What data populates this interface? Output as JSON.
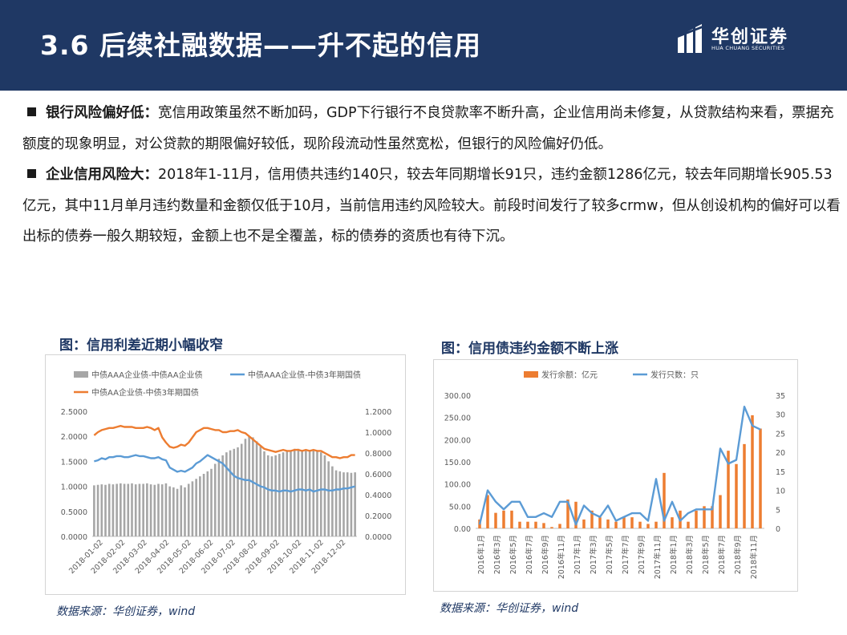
{
  "header": {
    "title": "3.6 后续社融数据——升不起的信用",
    "logo_cn": "华创证券",
    "logo_en": "HUA CHUANG SECURITIES",
    "bg_color": "#1f3864"
  },
  "paragraphs": [
    {
      "title": "银行风险偏好低",
      "sep": "：",
      "text": "宽信用政策虽然不断加码，GDP下行银行不良贷款率不断升高，企业信用尚未修复，从贷款结构来看，票据充额度的现象明显，对公贷款的期限偏好较低，现阶段流动性虽然宽松，但银行的风险偏好仍低。"
    },
    {
      "title": "企业信用风险大",
      "sep": "：",
      "text": "2018年1-11月，信用债共违约140只，较去年同期增长91只，违约金额1286亿元，较去年同期增长905.53亿元，其中11月单月违约数量和金额仅低于10月，当前信用违约风险较大。前段时间发行了较多crmw，但从创设机构的偏好可以看出标的债券一般久期较短，金额上也不是全覆盖，标的债券的资质也有待下沉。"
    }
  ],
  "figures": {
    "left_title": "图：信用利差近期小幅收窄",
    "right_title": "图：信用债违约金额不断上涨",
    "left_source": "数据来源：华创证券，wind",
    "right_source": "数据来源：华创证券，wind"
  },
  "chart_data": [
    {
      "type": "bar",
      "title": "",
      "legend": [
        "中债AAA企业债-中债AA企业债",
        "中债AAA企业债-中债3年期国债",
        "中债AA企业债-中债3年期国债"
      ],
      "legend_placement": "top",
      "colors": [
        "#a6a6a6",
        "#5b9bd5",
        "#ed7d31"
      ],
      "x_tick_labels": [
        "2018-01-02",
        "2018-02-02",
        "2018-03-02",
        "2018-04-02",
        "2018-05-02",
        "2018-06-02",
        "2018-07-02",
        "2018-08-02",
        "2018-09-02",
        "2018-10-02",
        "2018-11-02",
        "2018-12-02"
      ],
      "left_axis": {
        "ylim": [
          0,
          2.5
        ],
        "ticks": [
          "0.0000",
          "0.5000",
          "1.0000",
          "1.5000",
          "2.0000",
          "2.5000"
        ]
      },
      "right_axis": {
        "ylim": [
          0,
          1.2
        ],
        "ticks": [
          "0.0000",
          "0.2000",
          "0.4000",
          "0.6000",
          "0.8000",
          "1.0000",
          "1.2000"
        ]
      },
      "grid": false,
      "series": [
        {
          "name": "中债AAA企业债-中债AA企业债",
          "axis": "left",
          "kind": "bar",
          "values": [
            1.02,
            1.03,
            1.04,
            1.03,
            1.05,
            1.04,
            1.05,
            1.06,
            1.05,
            1.05,
            1.06,
            1.04,
            1.05,
            1.05,
            1.06,
            1.04,
            1.03,
            1.05,
            1.04,
            1.06,
            1.0,
            0.98,
            0.95,
            1.02,
            0.98,
            1.05,
            1.1,
            1.15,
            1.2,
            1.25,
            1.3,
            1.35,
            1.45,
            1.55,
            1.62,
            1.68,
            1.72,
            1.75,
            1.78,
            1.85,
            1.95,
            2.0,
            1.98,
            1.9,
            1.8,
            1.7,
            1.62,
            1.6,
            1.62,
            1.65,
            1.68,
            1.7,
            1.72,
            1.75,
            1.75,
            1.72,
            1.74,
            1.73,
            1.72,
            1.7,
            1.68,
            1.62,
            1.5,
            1.4,
            1.32,
            1.3,
            1.28,
            1.28,
            1.27,
            1.28
          ]
        },
        {
          "name": "中债AAA企业债-中债3年期国债",
          "axis": "right",
          "kind": "line",
          "values": [
            0.72,
            0.73,
            0.75,
            0.74,
            0.76,
            0.76,
            0.77,
            0.77,
            0.76,
            0.76,
            0.77,
            0.78,
            0.77,
            0.77,
            0.76,
            0.75,
            0.75,
            0.76,
            0.74,
            0.73,
            0.66,
            0.64,
            0.62,
            0.63,
            0.62,
            0.64,
            0.66,
            0.7,
            0.72,
            0.75,
            0.78,
            0.76,
            0.74,
            0.72,
            0.7,
            0.66,
            0.62,
            0.58,
            0.56,
            0.55,
            0.54,
            0.54,
            0.52,
            0.5,
            0.48,
            0.47,
            0.45,
            0.44,
            0.44,
            0.43,
            0.44,
            0.44,
            0.43,
            0.44,
            0.45,
            0.45,
            0.44,
            0.45,
            0.43,
            0.44,
            0.45,
            0.45,
            0.44,
            0.44,
            0.45,
            0.45,
            0.46,
            0.46,
            0.47,
            0.48
          ]
        },
        {
          "name": "中债AA企业债-中债3年期国债",
          "axis": "right",
          "kind": "line",
          "values": [
            0.97,
            1.0,
            1.02,
            1.03,
            1.04,
            1.04,
            1.05,
            1.06,
            1.05,
            1.05,
            1.05,
            1.04,
            1.04,
            1.04,
            1.05,
            1.04,
            1.02,
            1.04,
            0.95,
            0.9,
            0.86,
            0.85,
            0.86,
            0.88,
            0.87,
            0.9,
            0.95,
            1.0,
            1.02,
            1.04,
            1.04,
            1.03,
            1.02,
            1.02,
            1.0,
            1.0,
            1.01,
            1.01,
            1.02,
            1.0,
            0.99,
            0.96,
            0.93,
            0.9,
            0.87,
            0.84,
            0.83,
            0.82,
            0.81,
            0.82,
            0.83,
            0.82,
            0.82,
            0.83,
            0.83,
            0.82,
            0.83,
            0.82,
            0.83,
            0.82,
            0.82,
            0.8,
            0.78,
            0.76,
            0.76,
            0.75,
            0.76,
            0.76,
            0.78,
            0.78
          ]
        }
      ]
    },
    {
      "type": "bar",
      "title": "",
      "legend": [
        "发行余额：亿元",
        "发行只数：只"
      ],
      "legend_placement": "top",
      "colors": [
        "#ed7d31",
        "#5b9bd5"
      ],
      "x_tick_labels": [
        "2016年1月",
        "2016年3月",
        "2016年5月",
        "2016年7月",
        "2016年9月",
        "2016年11月",
        "2017年1月",
        "2017年3月",
        "2017年5月",
        "2017年7月",
        "2017年9月",
        "2017年11月",
        "2018年1月",
        "2018年3月",
        "2018年5月",
        "2018年7月",
        "2018年9月",
        "2018年11月"
      ],
      "left_axis": {
        "ylim": [
          0,
          300
        ],
        "ticks": [
          "0.00",
          "50.00",
          "100.00",
          "150.00",
          "200.00",
          "250.00",
          "300.00"
        ]
      },
      "right_axis": {
        "ylim": [
          0,
          35
        ],
        "ticks": [
          "0",
          "5",
          "10",
          "15",
          "20",
          "25",
          "30",
          "35"
        ]
      },
      "grid": false,
      "series": [
        {
          "name": "发行余额：亿元",
          "axis": "left",
          "kind": "bar",
          "values": [
            20,
            75,
            35,
            40,
            40,
            15,
            15,
            15,
            12,
            3,
            10,
            65,
            60,
            20,
            40,
            25,
            20,
            15,
            25,
            25,
            15,
            10,
            15,
            125,
            25,
            40,
            15,
            40,
            50,
            50,
            75,
            175,
            145,
            190,
            255,
            225
          ]
        },
        {
          "name": "发行只数：只",
          "axis": "right",
          "kind": "line",
          "values": [
            1,
            10,
            7,
            5,
            7,
            7,
            3,
            3,
            4,
            3,
            7,
            7,
            1,
            6,
            4,
            3,
            6,
            2,
            3,
            4,
            4,
            2,
            13,
            2,
            7,
            2,
            4,
            5,
            5,
            5,
            21,
            17,
            18,
            32,
            27,
            26
          ]
        }
      ]
    }
  ]
}
